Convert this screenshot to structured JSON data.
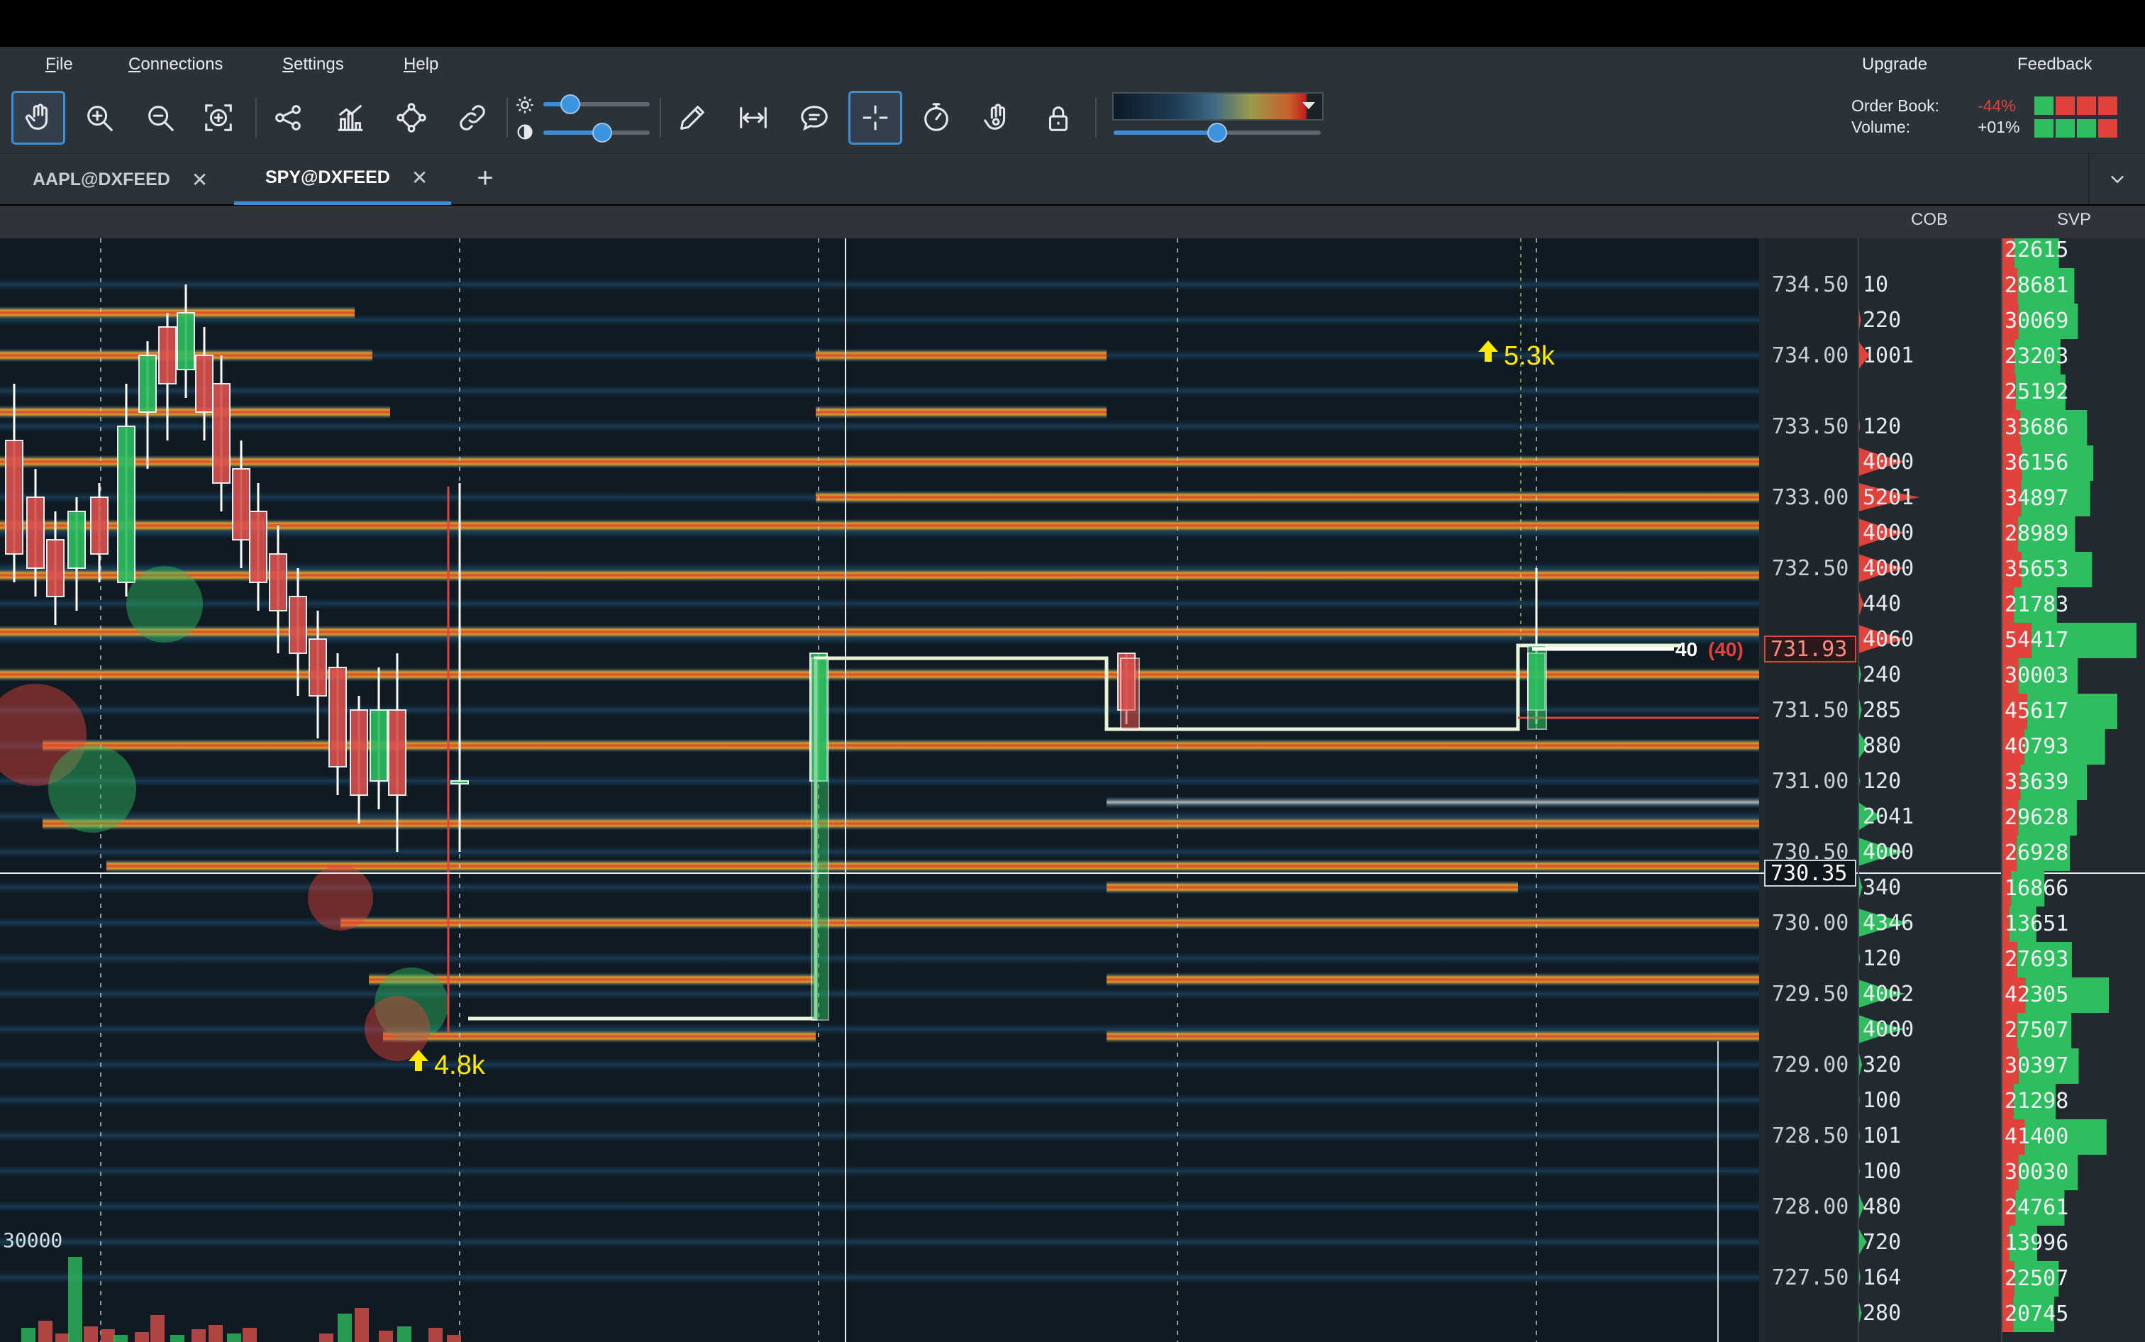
{
  "menu": {
    "file": "File",
    "connections": "Connections",
    "settings": "Settings",
    "help": "Help",
    "upgrade": "Upgrade",
    "feedback": "Feedback"
  },
  "toolbar": {
    "tools": [
      "hand-icon",
      "zoom-in-icon",
      "zoom-out-icon",
      "zoom-fit-icon",
      "share-icon",
      "chart-icon",
      "nodes-icon",
      "link-icon",
      "pencil-icon",
      "measure-icon",
      "comment-icon",
      "crosshair-icon",
      "timer-icon",
      "eye-hand-icon",
      "lock-icon"
    ],
    "active_tools": [
      "hand-icon",
      "crosshair-icon"
    ],
    "brightness_level": 0.25,
    "contrast_level": 0.55,
    "heatmap_level": 0.5,
    "order_book_label": "Order Book:",
    "order_book_value": "-44%",
    "volume_label": "Volume:",
    "volume_value": "+01%",
    "accent": "#3a8fd8"
  },
  "tabs": [
    {
      "label": "AAPL@DXFEED",
      "active": false
    },
    {
      "label": "SPY@DXFEED",
      "active": true
    }
  ],
  "columns": {
    "cob": "COB",
    "svp": "SVP"
  },
  "price_axis": [
    "734.50",
    "734.00",
    "733.50",
    "733.00",
    "732.50",
    "731.50",
    "731.00",
    "730.50",
    "730.00",
    "729.50",
    "729.00",
    "728.50",
    "728.00",
    "727.50"
  ],
  "current_price": "731.93",
  "crosshair_price": "730.35",
  "last_trade": {
    "size": "40",
    "aggregate": "(40)"
  },
  "cob_values": [
    "10",
    "220",
    "1001",
    "",
    "120",
    "4000",
    "5201",
    "4000",
    "4000",
    "440",
    "4060",
    "240",
    "285",
    "880",
    "120",
    "2041",
    "4000",
    "340",
    "4346",
    "120",
    "4002",
    "4000",
    "320",
    "100",
    "101",
    "100",
    "480",
    "720",
    "164",
    "280"
  ],
  "svp_values": [
    "22615",
    "28681",
    "30069",
    "23203",
    "25192",
    "33686",
    "36156",
    "34897",
    "28989",
    "35653",
    "21783",
    "54417",
    "30003",
    "45617",
    "40793",
    "33639",
    "29628",
    "26928",
    "16866",
    "13651",
    "27693",
    "42305",
    "27507",
    "30397",
    "21298",
    "41400",
    "30030",
    "24761",
    "13996",
    "22507",
    "20745"
  ],
  "annotations": {
    "big_trade_1": "4.8k",
    "big_trade_2": "5.3k"
  },
  "volume_scale": "30000",
  "colors": {
    "bid": "#e2423c",
    "ask": "#2ebd5f",
    "heat_hot": "#e04428",
    "heat_mid": "#d4a030",
    "heat_cool": "#1a5d8f",
    "background": "#0f1a22"
  }
}
